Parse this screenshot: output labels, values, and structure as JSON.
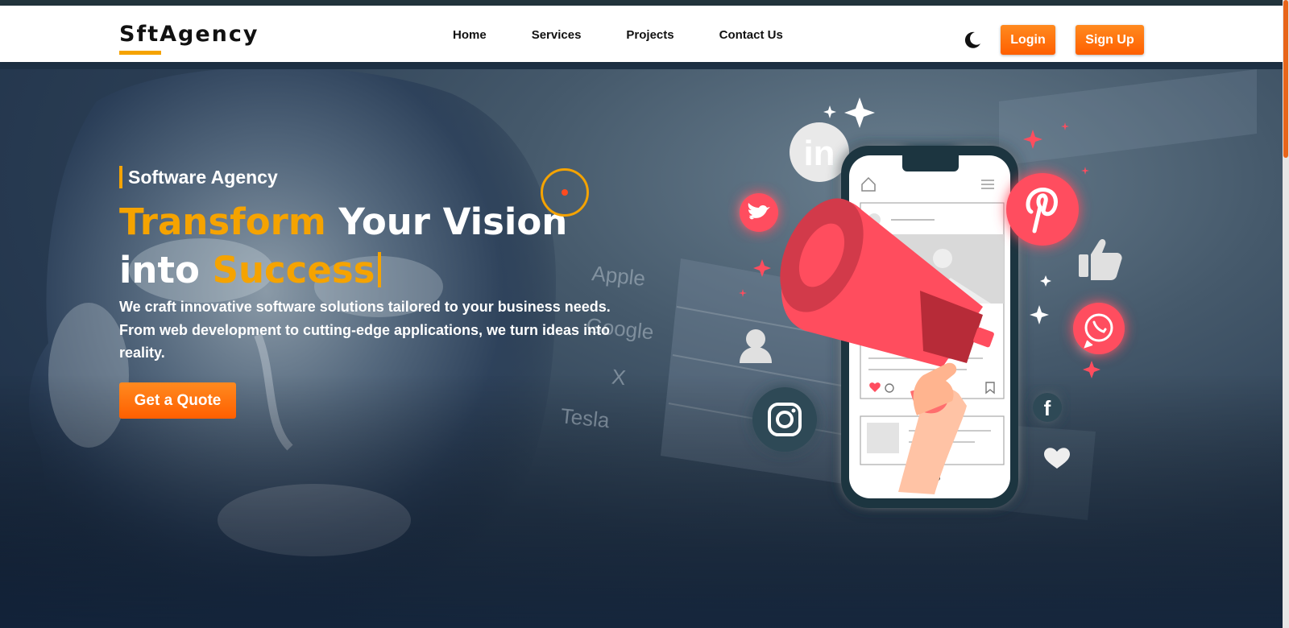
{
  "brand": {
    "name": "SftAgency"
  },
  "nav": {
    "links": [
      {
        "label": "Home"
      },
      {
        "label": "Services"
      },
      {
        "label": "Projects"
      },
      {
        "label": "Contact Us"
      }
    ],
    "theme_icon": "moon-icon",
    "login_label": "Login",
    "signup_label": "Sign Up"
  },
  "hero": {
    "eyebrow": "Software Agency",
    "headline": {
      "line1_accent": "Transform",
      "line1_rest": " Your Vision",
      "line2_start": "into ",
      "line2_accent": "Success"
    },
    "description": "We craft innovative software solutions tailored to your business needs. From web development to cutting-edge applications, we turn ideas into reality.",
    "cta_label": "Get a Quote"
  },
  "background_text": [
    "Apple",
    "Google",
    "X",
    "Tesla"
  ],
  "illustration": {
    "icons": [
      "linkedin-icon",
      "twitter-icon",
      "pinterest-icon",
      "whatsapp-icon",
      "instagram-icon",
      "facebook-icon",
      "user-icon",
      "thumbs-up-icon",
      "heart-icon",
      "megaphone-icon",
      "phone-icon",
      "sparkle-icon"
    ]
  },
  "colors": {
    "accent": "#f5a300",
    "button": "#ff6a0d",
    "social_red": "#ff4d5e",
    "hero_bg": "#2a3d53"
  }
}
